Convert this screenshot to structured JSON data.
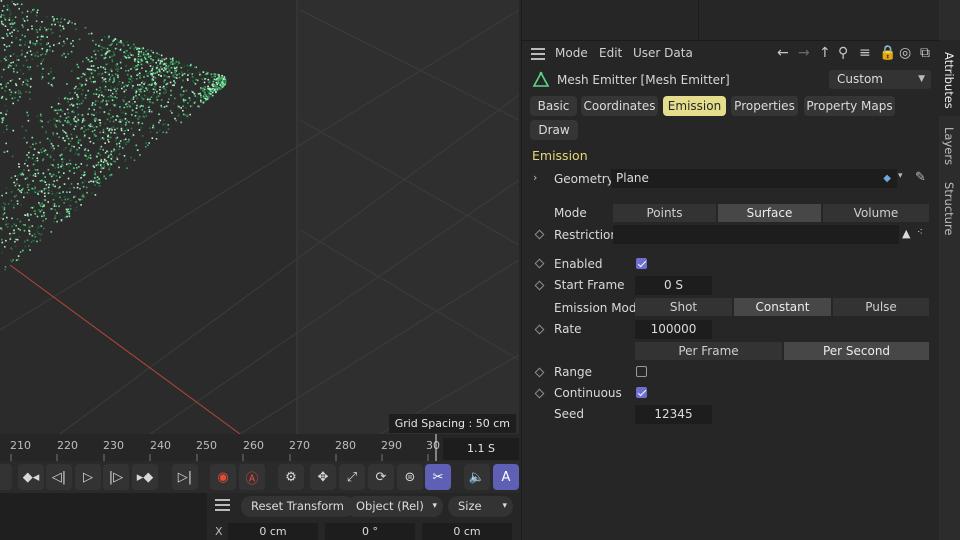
{
  "viewport": {
    "grid_spacing": "Grid Spacing : 50 cm"
  },
  "timeline": {
    "ticks": [
      "210",
      "220",
      "230",
      "240",
      "250",
      "260",
      "270",
      "280",
      "290",
      "30"
    ],
    "current_frame": "1.1 S"
  },
  "coords": {
    "reset_transform": "Reset Transform",
    "object_mode": "Object (Rel)",
    "size_mode": "Size",
    "axis_label": "X",
    "position_x": "0 cm",
    "rotation_x": "0 °",
    "size_x": "0 cm"
  },
  "panel": {
    "menu": {
      "mode": "Mode",
      "edit": "Edit",
      "user_data": "User Data"
    },
    "object_title": "Mesh Emitter [Mesh Emitter]",
    "layout_dropdown": "Custom",
    "tabs": [
      "Basic",
      "Coordinates",
      "Emission",
      "Properties",
      "Property Maps",
      "Draw"
    ],
    "active_tab": "Emission",
    "section_title": "Emission",
    "geometry": {
      "label": "Geometry",
      "value": "Plane"
    },
    "mode": {
      "label": "Mode",
      "options": [
        "Points",
        "Surface",
        "Volume"
      ],
      "selected": "Surface"
    },
    "restriction": {
      "label": "Restriction",
      "value": ""
    },
    "enabled": {
      "label": "Enabled",
      "checked": true
    },
    "start_frame": {
      "label": "Start Frame",
      "value": "0 S"
    },
    "emission_mode": {
      "label": "Emission Mode",
      "options": [
        "Shot",
        "Constant",
        "Pulse"
      ],
      "selected": "Constant"
    },
    "rate": {
      "label": "Rate",
      "value": "100000",
      "units": [
        "Per Frame",
        "Per Second"
      ],
      "selected_unit": "Per Second"
    },
    "range": {
      "label": "Range",
      "checked": false
    },
    "continuous": {
      "label": "Continuous",
      "checked": true
    },
    "seed": {
      "label": "Seed",
      "value": "12345"
    }
  },
  "side_tabs": [
    "Attributes",
    "Layers",
    "Structure"
  ],
  "colors": {
    "accent_tab": "#e4dd8c",
    "section_title": "#e6d679",
    "checkbox": "#6e6fd0",
    "particles": "#5fd68a"
  }
}
